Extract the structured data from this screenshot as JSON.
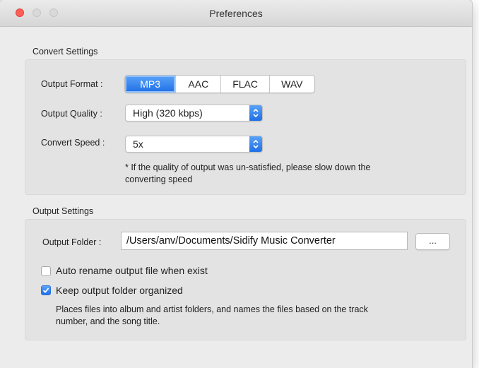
{
  "window": {
    "title": "Preferences"
  },
  "convert_settings": {
    "section_title": "Convert Settings",
    "output_format": {
      "label": "Output Format :",
      "options": [
        "MP3",
        "AAC",
        "FLAC",
        "WAV"
      ],
      "selected": "MP3"
    },
    "output_quality": {
      "label": "Output Quality :",
      "value": "High (320 kbps)"
    },
    "convert_speed": {
      "label": "Convert Speed :",
      "value": "5x"
    },
    "hint_line1": "* If the quality of output was un-satisfied, please slow down the",
    "hint_line2": "converting speed"
  },
  "output_settings": {
    "section_title": "Output Settings",
    "output_folder": {
      "label": "Output Folder :",
      "value": "/Users/anv/Documents/Sidify Music Converter",
      "browse_label": "..."
    },
    "auto_rename": {
      "label": "Auto rename output file when exist",
      "checked": false
    },
    "keep_organized": {
      "label": "Keep output folder organized",
      "checked": true
    },
    "description_line1": "Places files into album and artist folders, and names the files based on the track",
    "description_line2": "number, and the song title."
  },
  "colors": {
    "accent": "#1f6fe6",
    "close_button": "#fc5f57",
    "panel_bg": "#e3e3e3",
    "window_bg": "#ececec"
  }
}
